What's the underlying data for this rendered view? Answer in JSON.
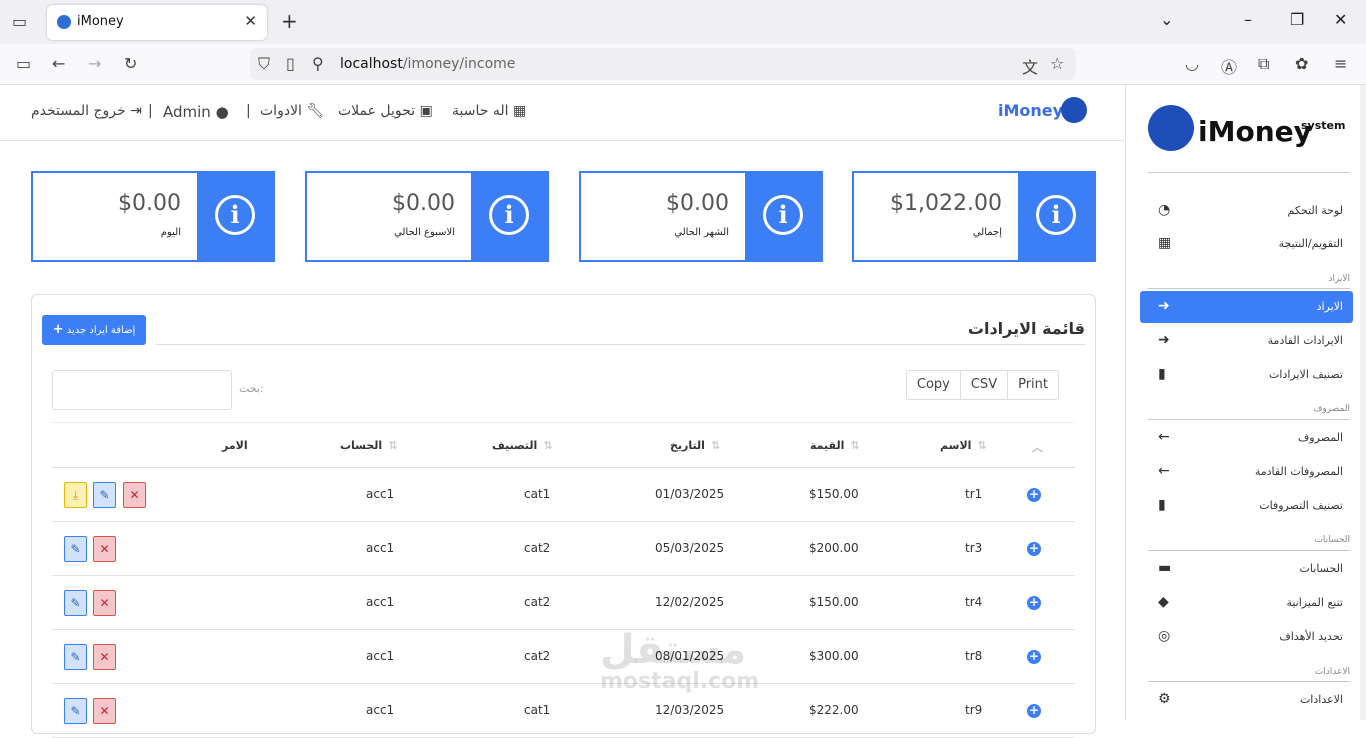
{
  "browser": {
    "tab_title": "iMoney",
    "url_host": "localhost",
    "url_path": "/imoney/income"
  },
  "topnav": {
    "brand": "iMoney",
    "calculator": "اله حاسبة",
    "currency": "تحويل عملات",
    "tools": "الادوات",
    "user": "Admin",
    "logout": "خروج المستخدم",
    "sep": "|"
  },
  "cards": [
    {
      "value": "$1,022.00",
      "label": "إجمالي"
    },
    {
      "value": "$0.00",
      "label": "الشهر الحالي"
    },
    {
      "value": "$0.00",
      "label": "الاسبوع الحالي"
    },
    {
      "value": "$0.00",
      "label": "اليوم"
    }
  ],
  "panel": {
    "title": "قائمة الايرادات",
    "add_button": "إضافة ايراد جديد",
    "copy": "Copy",
    "csv": "CSV",
    "print": "Print",
    "search_label": "بحث:"
  },
  "table": {
    "headers": {
      "name": "الاسم",
      "amount": "القيمة",
      "date": "التاريخ",
      "category": "التصنيف",
      "account": "الحساب",
      "command": "الامر"
    },
    "rows": [
      {
        "name": "tr1",
        "amount": "$150.00",
        "date": "01/03/2025",
        "category": "cat1",
        "account": "acc1"
      },
      {
        "name": "tr3",
        "amount": "$200.00",
        "date": "05/03/2025",
        "category": "cat2",
        "account": "acc1"
      },
      {
        "name": "tr4",
        "amount": "$150.00",
        "date": "12/02/2025",
        "category": "cat2",
        "account": "acc1"
      },
      {
        "name": "tr8",
        "amount": "$300.00",
        "date": "08/01/2025",
        "category": "cat2",
        "account": "acc1"
      },
      {
        "name": "tr9",
        "amount": "$222.00",
        "date": "12/03/2025",
        "category": "cat1",
        "account": "acc1"
      }
    ]
  },
  "watermark": {
    "arabic": "مستقل",
    "latin": "mostaql.com"
  },
  "sidebar": {
    "logo_text": "iMoney",
    "logo_sub": "system",
    "dashboard": "لوحة التحكم",
    "calendar": "التقويم/النتيجة",
    "sec_income": "الايراد",
    "income": "الايراد",
    "upcoming_income": "الايرادات القادمة",
    "income_categories": "تصنيف الايرادات",
    "sec_expense": "المصروف",
    "expense": "المصروف",
    "upcoming_expense": "المصروفات القادمة",
    "expense_categories": "تصنيف التصروفات",
    "sec_accounts": "الحسابات",
    "accounts": "الحسابات",
    "budget": "تتبع الميزانية",
    "goals": "تحديد الأهداف",
    "sec_settings": "الاعدادات",
    "settings": "الاعدادات"
  }
}
